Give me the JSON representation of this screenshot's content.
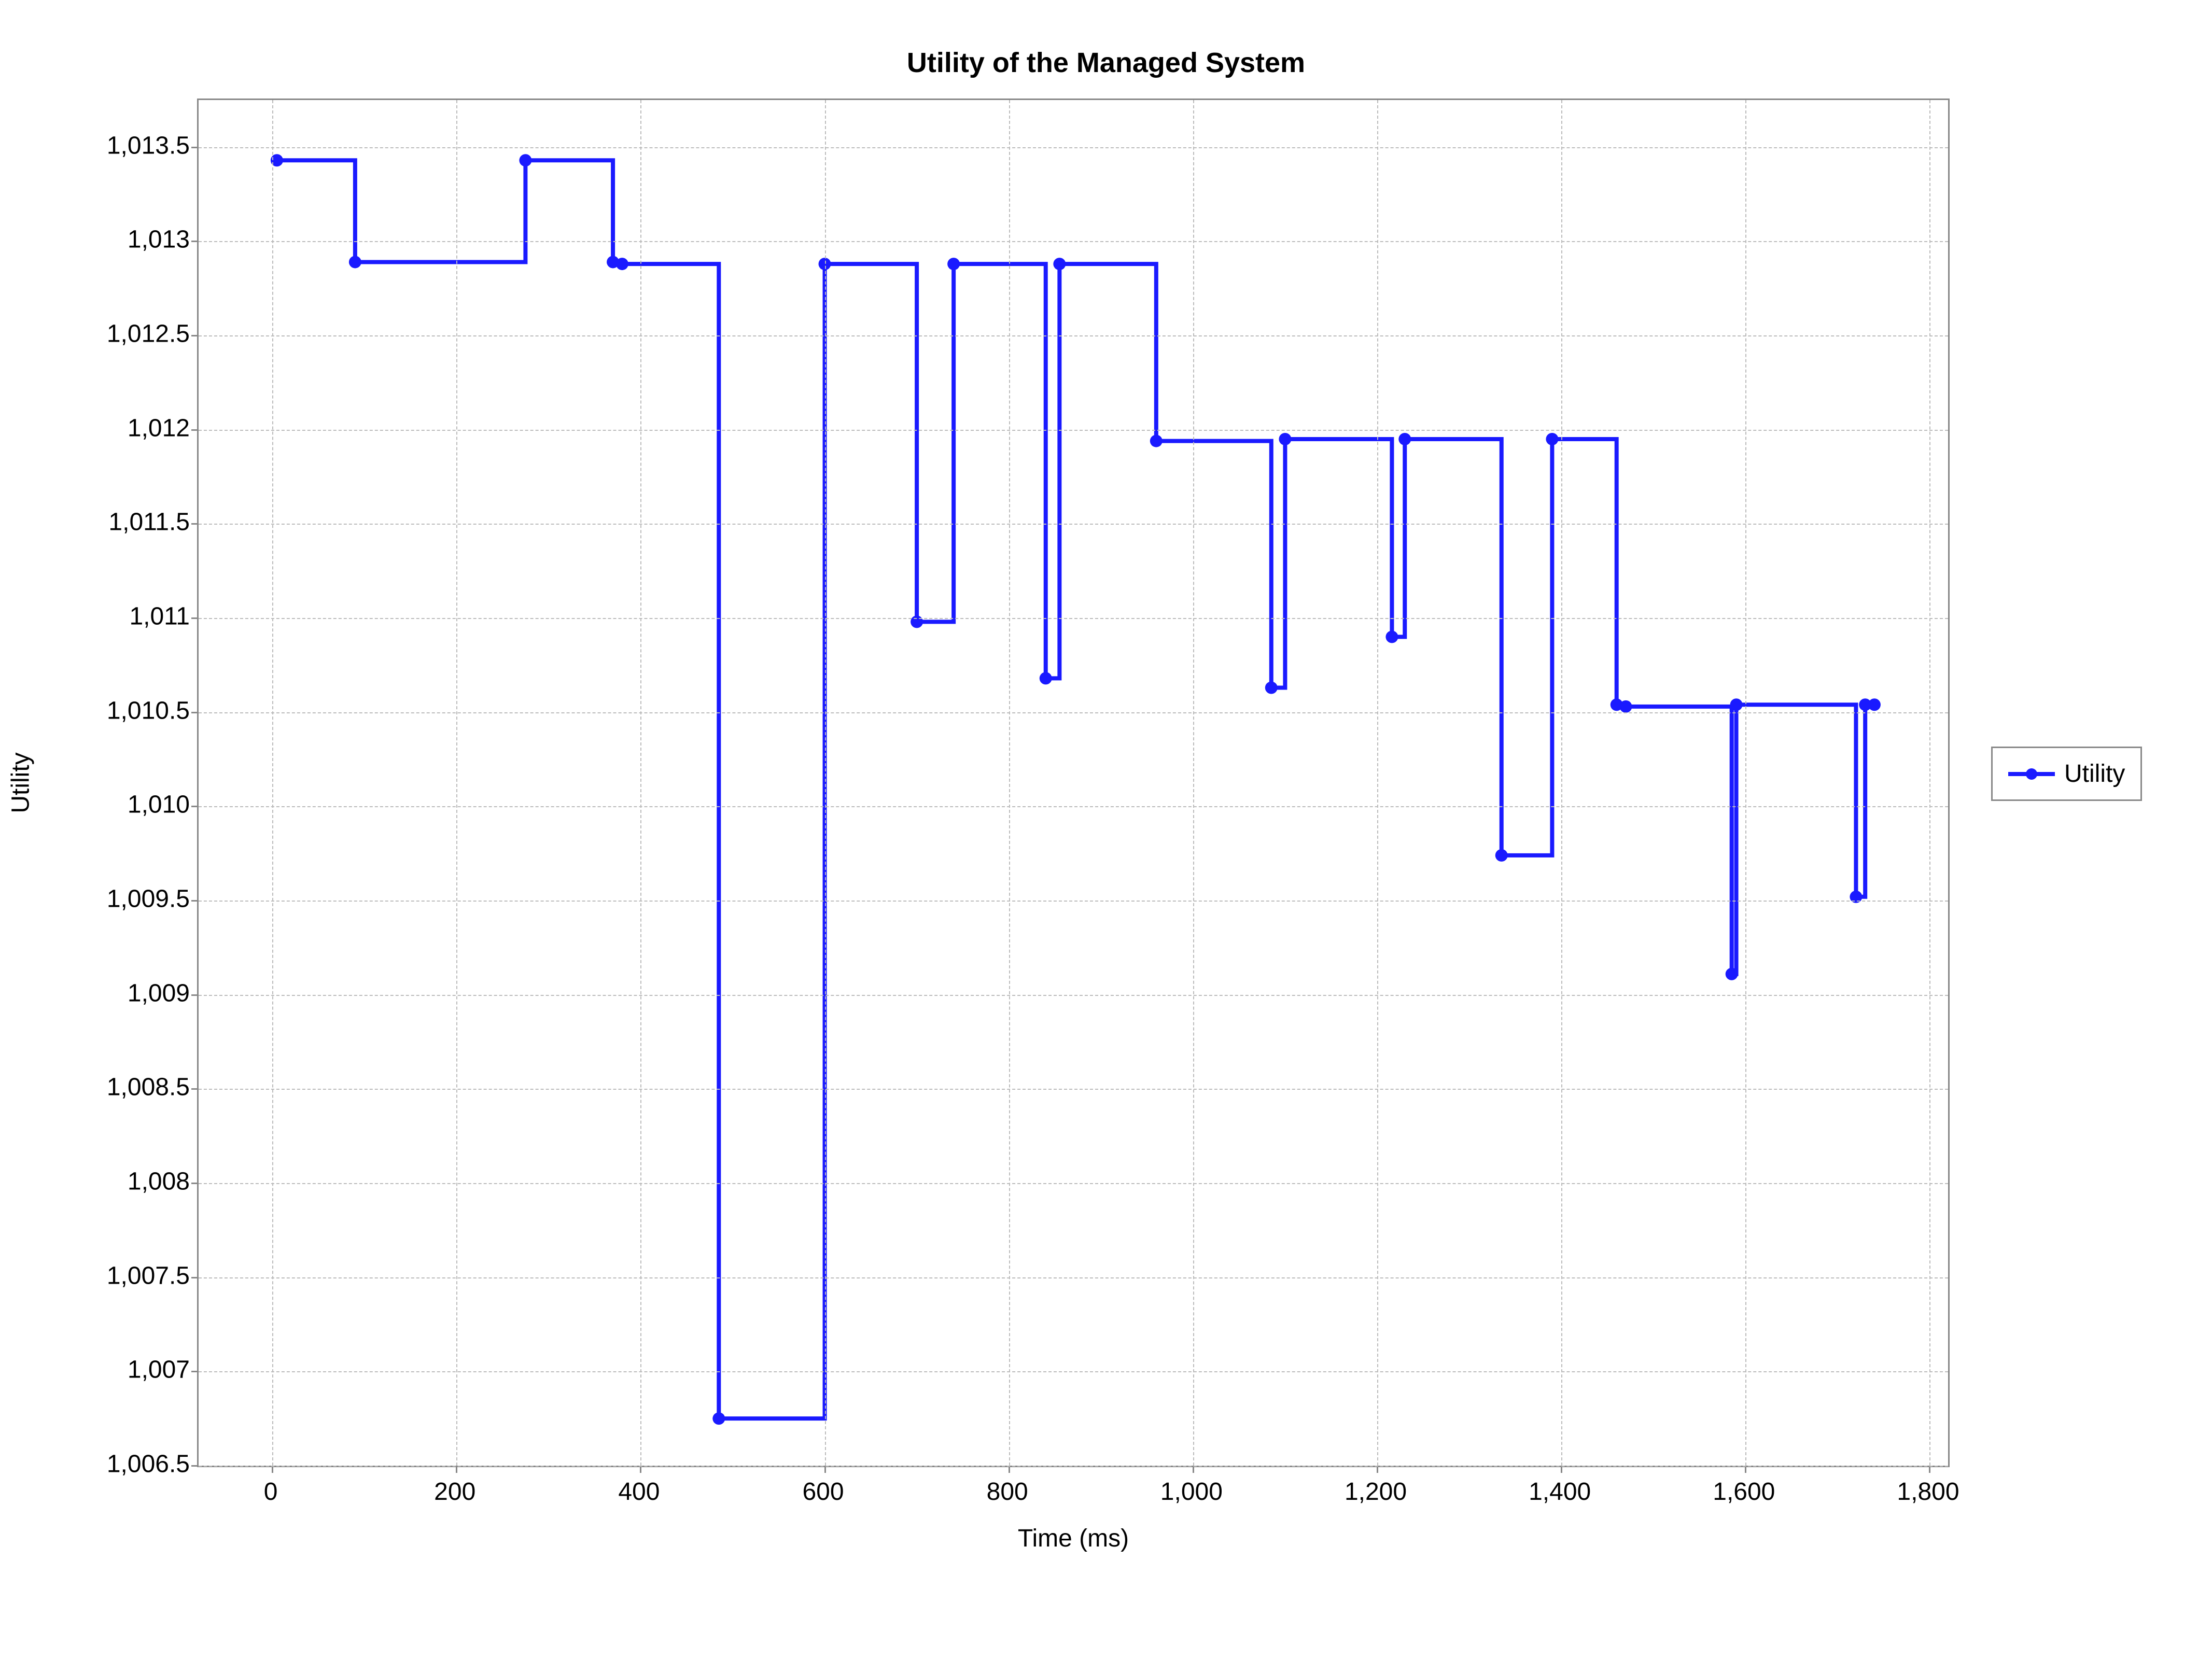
{
  "chart_data": {
    "type": "line",
    "step_mode": "after",
    "title": "Utility of the Managed System",
    "xlabel": "Time (ms)",
    "ylabel": "Utility",
    "xlim": [
      -80,
      1820
    ],
    "ylim": [
      1006.5,
      1013.75
    ],
    "x_ticks": [
      0,
      200,
      400,
      600,
      800,
      1000,
      1200,
      1400,
      1600,
      1800
    ],
    "y_ticks": [
      1006.5,
      1007,
      1007.5,
      1008,
      1008.5,
      1009,
      1009.5,
      1010,
      1010.5,
      1011,
      1011.5,
      1012,
      1012.5,
      1013,
      1013.5
    ],
    "y_tick_labels": [
      "1,006.5",
      "1,007",
      "1,007.5",
      "1,008",
      "1,008.5",
      "1,009",
      "1,009.5",
      "1,010",
      "1,010.5",
      "1,011",
      "1,011.5",
      "1,012",
      "1,012.5",
      "1,013",
      "1,013.5"
    ],
    "x_tick_labels": [
      "0",
      "200",
      "400",
      "600",
      "800",
      "1,000",
      "1,200",
      "1,400",
      "1,600",
      "1,800"
    ],
    "series": [
      {
        "name": "Utility",
        "color": "#1a1aff",
        "x": [
          5,
          90,
          275,
          370,
          380,
          485,
          600,
          700,
          740,
          840,
          855,
          960,
          1085,
          1100,
          1216,
          1230,
          1335,
          1390,
          1460,
          1470,
          1585,
          1590,
          1720,
          1730,
          1740
        ],
        "y": [
          1013.43,
          1012.89,
          1013.43,
          1012.89,
          1012.88,
          1006.75,
          1012.88,
          1010.98,
          1012.88,
          1010.68,
          1012.88,
          1011.94,
          1010.63,
          1011.95,
          1010.9,
          1011.95,
          1009.74,
          1011.95,
          1010.54,
          1010.53,
          1009.11,
          1010.54,
          1009.52,
          1010.54,
          1010.54
        ]
      }
    ],
    "legend": {
      "entries": [
        "Utility"
      ],
      "position": "right"
    },
    "grid": true
  },
  "title": "Utility of the Managed System",
  "xlabel": "Time (ms)",
  "ylabel": "Utility",
  "legend_label": "Utility"
}
